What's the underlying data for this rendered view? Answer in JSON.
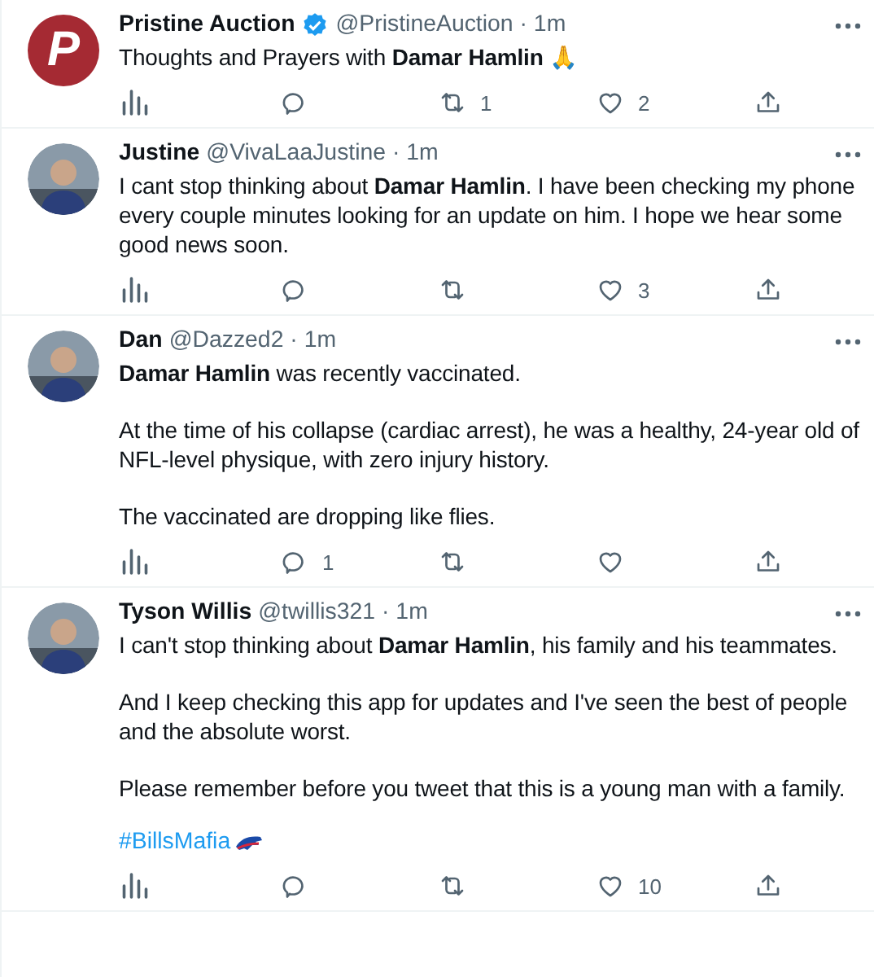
{
  "tweets": [
    {
      "avatar": {
        "kind": "logo",
        "letter": "P"
      },
      "name": "Pristine Auction",
      "verified": true,
      "handle": "@PristineAuction",
      "time": "· 1m",
      "paragraphs": [
        "Thoughts and Prayers with **Damar Hamlin** 🙏"
      ],
      "actions": [
        {
          "kind": "views"
        },
        {
          "kind": "reply"
        },
        {
          "kind": "retweet",
          "count": "1"
        },
        {
          "kind": "like",
          "count": "2"
        },
        {
          "kind": "share"
        }
      ]
    },
    {
      "avatar": {
        "kind": "picture"
      },
      "name": "Justine",
      "verified": false,
      "handle": "@VivaLaaJustine",
      "time": "· 1m",
      "paragraphs": [
        "I cant stop thinking about **Damar Hamlin**. I have been checking my phone every couple minutes looking for an update on him. I hope we hear some good news soon."
      ],
      "actions": [
        {
          "kind": "views"
        },
        {
          "kind": "reply"
        },
        {
          "kind": "retweet"
        },
        {
          "kind": "like",
          "count": "3"
        },
        {
          "kind": "share"
        }
      ]
    },
    {
      "avatar": {
        "kind": "picture"
      },
      "name": "Dan",
      "verified": false,
      "handle": "@Dazzed2",
      "time": "· 1m",
      "paragraphs": [
        "**Damar Hamlin** was recently vaccinated.",
        "At the time of his collapse (cardiac arrest), he was a healthy, 24-year old of NFL-level physique, with zero injury history.",
        "The vaccinated are dropping like flies."
      ],
      "actions": [
        {
          "kind": "views"
        },
        {
          "kind": "reply",
          "count": "1"
        },
        {
          "kind": "retweet"
        },
        {
          "kind": "like"
        },
        {
          "kind": "share"
        }
      ]
    },
    {
      "avatar": {
        "kind": "picture"
      },
      "name": "Tyson Willis",
      "verified": false,
      "handle": "@twillis321",
      "time": "· 1m",
      "paragraphs": [
        "I can't stop thinking about **Damar Hamlin**, his family and his teammates.",
        "And I keep checking this app for updates and I've seen the best of people and the absolute worst.",
        "Please remember before you tweet that this is a young man with a family."
      ],
      "hashtag": "#BillsMafia",
      "actions": [
        {
          "kind": "views"
        },
        {
          "kind": "reply"
        },
        {
          "kind": "retweet"
        },
        {
          "kind": "like",
          "count": "10"
        },
        {
          "kind": "share"
        }
      ]
    }
  ]
}
